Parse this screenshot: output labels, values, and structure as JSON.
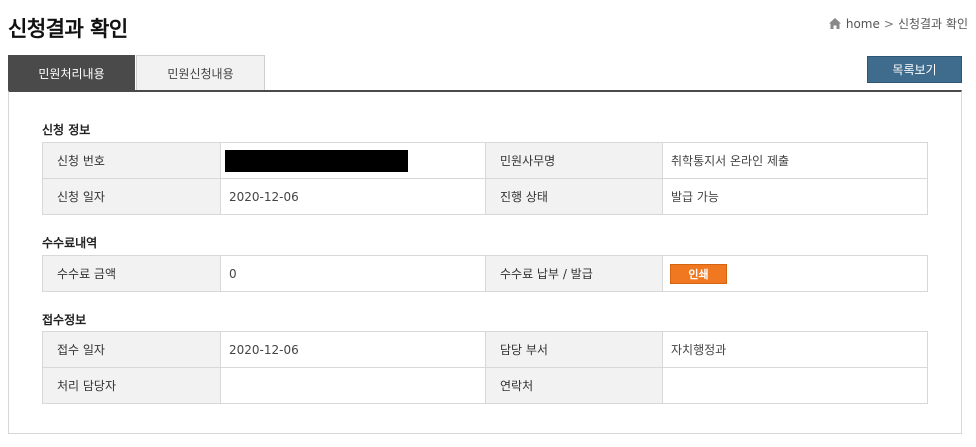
{
  "page": {
    "title": "신청결과 확인"
  },
  "breadcrumb": {
    "home": "home",
    "current": "신청결과 확인",
    "separator": ">"
  },
  "tabs": [
    {
      "label": "민원처리내용",
      "active": true
    },
    {
      "label": "민원신청내용",
      "active": false
    }
  ],
  "list_button": {
    "label": "목록보기"
  },
  "sections": {
    "application": {
      "title": "신청 정보",
      "number_label": "신청 번호",
      "office_label": "민원사무명",
      "office_value": "취학통지서 온라인 제출",
      "date_label": "신청 일자",
      "date_value": "2020-12-06",
      "status_label": "진행 상태",
      "status_value": "발급 가능"
    },
    "fee": {
      "title": "수수료내역",
      "amount_label": "수수료 금액",
      "amount_value": "0",
      "payment_label": "수수료 납부 / 발급",
      "print_label": "인쇄"
    },
    "receipt": {
      "title": "접수정보",
      "date_label": "접수 일자",
      "date_value": "2020-12-06",
      "dept_label": "담당 부서",
      "dept_value": "자치행정과",
      "handler_label": "처리 담당자",
      "handler_value": "",
      "contact_label": "연락처",
      "contact_value": ""
    }
  },
  "colors": {
    "tab_active": "#4a4a4a",
    "list_button": "#3f6b8c",
    "print_button": "#f07820"
  },
  "icons": {
    "breadcrumb_home": "home-icon",
    "breadcrumb_separator": "chevron-right-icon"
  }
}
